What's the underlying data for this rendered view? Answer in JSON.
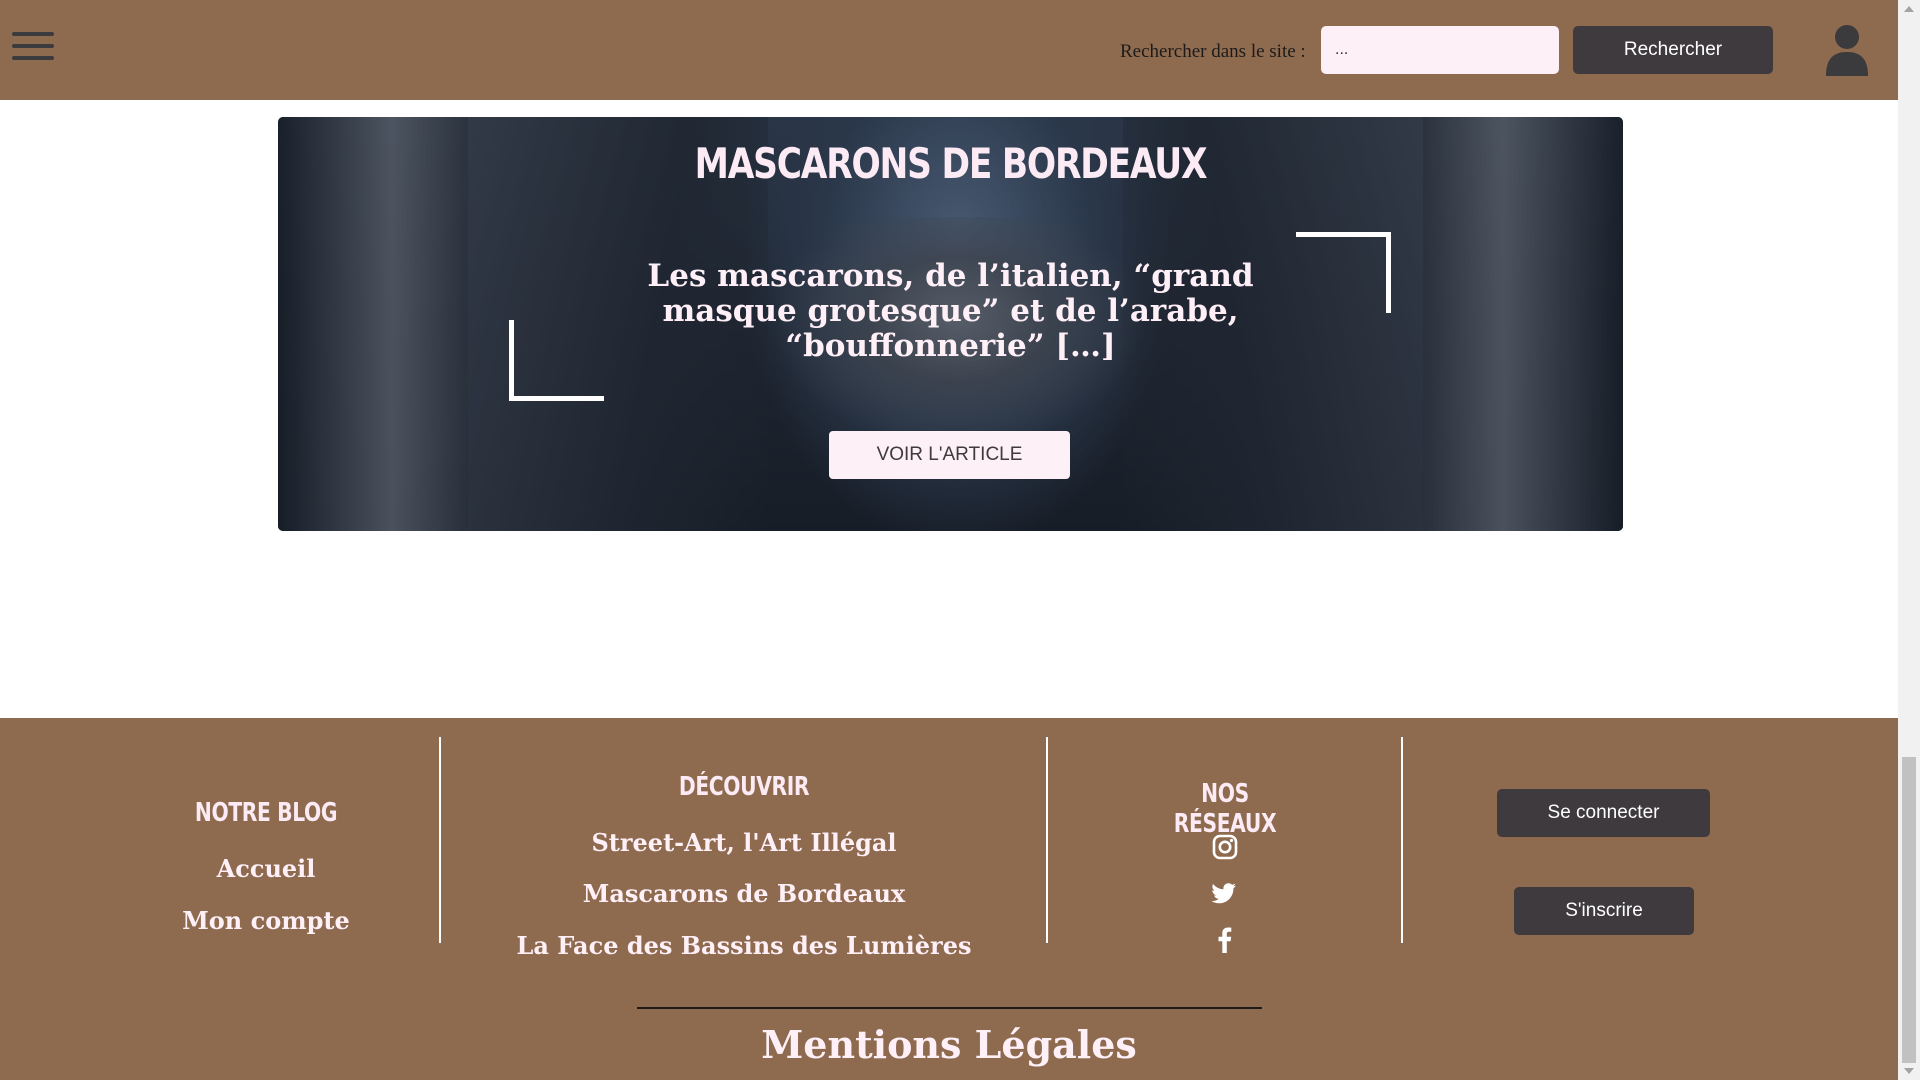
{
  "header": {
    "menu_icon": "hamburger-menu-icon",
    "search_label": "Rechercher dans le site :",
    "search_value": "...",
    "search_button": "Rechercher",
    "user_icon": "user-account-icon"
  },
  "banner": {
    "title": "Mascarons de Bordeaux",
    "excerpt": "Les mascarons, de l’italien, “grand masque grotesque” et de l’arabe, “bouffonnerie” […]",
    "button": "Voir l'article"
  },
  "footer": {
    "blog": {
      "title": "Notre blog",
      "links": [
        "Accueil",
        "Mon compte"
      ]
    },
    "discover": {
      "title": "Découvrir",
      "links": [
        "Street-Art, l'Art Illégal",
        "Mascarons de Bordeaux",
        "La Face des Bassins des Lumières"
      ]
    },
    "social": {
      "title": "Nos réseaux",
      "icons": [
        "instagram-icon",
        "twitter-icon",
        "facebook-icon"
      ]
    },
    "account": {
      "login": "Se connecter",
      "register": "S'inscrire"
    },
    "legal": "Mentions Légales"
  },
  "colors": {
    "brand_brown": "#8e6a4f",
    "dark_button": "#3e3a3d",
    "light_pink": "#fdf0f7"
  }
}
